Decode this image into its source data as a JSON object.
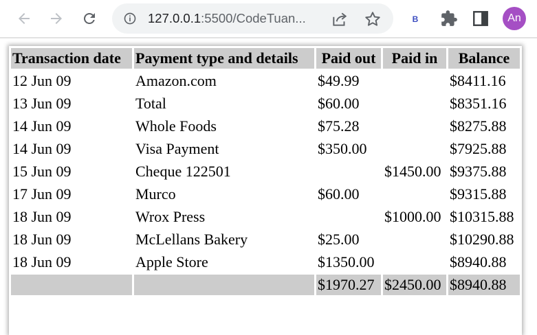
{
  "browser": {
    "url_host": "127.0.0.1",
    "url_rest": ":5500/CodeTuan...",
    "extension_label": "B",
    "avatar_initials": "An",
    "avatar_color": "#a54fc4"
  },
  "table": {
    "headers": [
      "Transaction date",
      "Payment type and details",
      "Paid out",
      "Paid in",
      "Balance"
    ],
    "rows": [
      [
        "12 Jun 09",
        "Amazon.com",
        "$49.99",
        "",
        "$8411.16"
      ],
      [
        "13 Jun 09",
        "Total",
        "$60.00",
        "",
        "$8351.16"
      ],
      [
        "14 Jun 09",
        "Whole Foods",
        "$75.28",
        "",
        "$8275.88"
      ],
      [
        "14 Jun 09",
        "Visa Payment",
        "$350.00",
        "",
        "$7925.88"
      ],
      [
        "15 Jun 09",
        "Cheque 122501",
        "",
        "$1450.00",
        "$9375.88"
      ],
      [
        "17 Jun 09",
        "Murco",
        "$60.00",
        "",
        "$9315.88"
      ],
      [
        "18 Jun 09",
        "Wrox Press",
        "",
        "$1000.00",
        "$10315.88"
      ],
      [
        "18 Jun 09",
        "McLellans Bakery",
        "$25.00",
        "",
        "$10290.88"
      ],
      [
        "18 Jun 09",
        "Apple Store",
        "$1350.00",
        "",
        "$8940.88"
      ]
    ],
    "footer": [
      "",
      "",
      "$1970.27",
      "$2450.00",
      "$8940.88"
    ],
    "header_bg": "#cccccc"
  }
}
